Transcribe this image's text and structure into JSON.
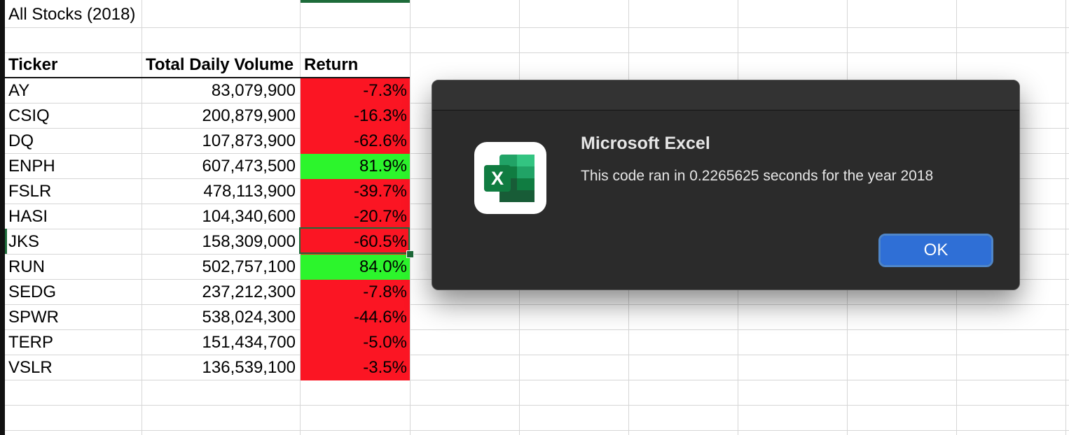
{
  "sheet": {
    "title": "All Stocks (2018)",
    "headers": {
      "ticker": "Ticker",
      "volume": "Total Daily Volume",
      "return": "Return"
    },
    "rows": [
      {
        "ticker": "AY",
        "volume": "83,079,900",
        "return": "-7.3%",
        "status": "negative"
      },
      {
        "ticker": "CSIQ",
        "volume": "200,879,900",
        "return": "-16.3%",
        "status": "negative"
      },
      {
        "ticker": "DQ",
        "volume": "107,873,900",
        "return": "-62.6%",
        "status": "negative"
      },
      {
        "ticker": "ENPH",
        "volume": "607,473,500",
        "return": "81.9%",
        "status": "positive"
      },
      {
        "ticker": "FSLR",
        "volume": "478,113,900",
        "return": "-39.7%",
        "status": "negative"
      },
      {
        "ticker": "HASI",
        "volume": "104,340,600",
        "return": "-20.7%",
        "status": "negative"
      },
      {
        "ticker": "JKS",
        "volume": "158,309,000",
        "return": "-60.5%",
        "status": "negative"
      },
      {
        "ticker": "RUN",
        "volume": "502,757,100",
        "return": "84.0%",
        "status": "positive"
      },
      {
        "ticker": "SEDG",
        "volume": "237,212,300",
        "return": "-7.8%",
        "status": "negative"
      },
      {
        "ticker": "SPWR",
        "volume": "538,024,300",
        "return": "-44.6%",
        "status": "negative"
      },
      {
        "ticker": "TERP",
        "volume": "151,434,700",
        "return": "-5.0%",
        "status": "negative"
      },
      {
        "ticker": "VSLR",
        "volume": "136,539,100",
        "return": "-3.5%",
        "status": "negative"
      }
    ],
    "selected_ticker": "JKS"
  },
  "colors": {
    "positive": "#2cf52c",
    "negative": "#fb1523",
    "selection": "#1e6b3a",
    "dialog_bg": "#2b2b2b",
    "button": "#2f6fd6"
  },
  "dialog": {
    "app_name": "Microsoft Excel",
    "message": "This code ran in 0.2265625 seconds for the year 2018",
    "ok_label": "OK",
    "icon": "excel-icon"
  }
}
